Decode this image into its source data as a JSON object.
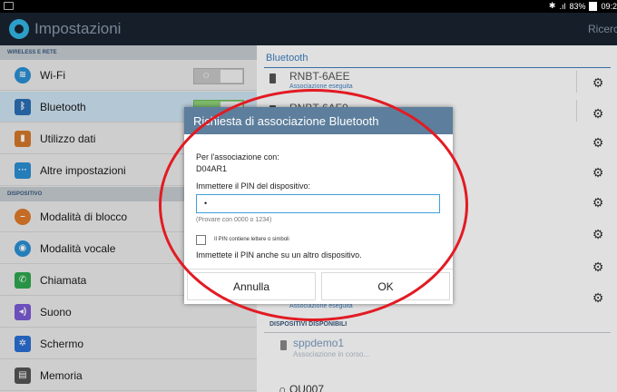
{
  "status_bar": {
    "battery": "83%",
    "time": "09:2"
  },
  "action_bar": {
    "title": "Impostazioni",
    "search": "Ricerc"
  },
  "left": {
    "section_wireless": "WIRELESS E RETE",
    "section_device": "DISPOSITIVO",
    "items": [
      {
        "label": "Wi-Fi",
        "icon": "wifi-icon",
        "color": "#2b8fd4"
      },
      {
        "label": "Bluetooth",
        "icon": "bluetooth-icon",
        "color": "#2b8fd4"
      },
      {
        "label": "Utilizzo dati",
        "icon": "data-usage-icon",
        "color": "#d4782b"
      },
      {
        "label": "Altre impostazioni",
        "icon": "more-icon",
        "color": "#2b8fd4"
      },
      {
        "label": "Modalità di blocco",
        "icon": "block-icon",
        "color": "#e07a2b"
      },
      {
        "label": "Modalità vocale",
        "icon": "voice-icon",
        "color": "#2b8fd4"
      },
      {
        "label": "Chiamata",
        "icon": "phone-icon",
        "color": "#2fa84f"
      },
      {
        "label": "Suono",
        "icon": "sound-icon",
        "color": "#7a5bd4"
      },
      {
        "label": "Schermo",
        "icon": "screen-icon",
        "color": "#2b6fd4"
      },
      {
        "label": "Memoria",
        "icon": "memory-icon",
        "color": "#555555"
      }
    ],
    "wifi_toggle": "O"
  },
  "right": {
    "header": "Bluetooth",
    "devices": [
      {
        "name": "RNBT-6AEE",
        "status": "Associazione eseguita"
      },
      {
        "name": "RNBT-6AF0",
        "status": ""
      }
    ],
    "partial_status": "Associazione eseguita",
    "section_available": "DISPOSITIVI DISPONIBILI",
    "available": [
      {
        "name": "sppdemo1",
        "status": "Associazione in corso..."
      }
    ],
    "headphones": "QU007"
  },
  "dialog": {
    "title": "Richiesta di associazione Bluetooth",
    "pairing_label": "Per l'associazione con:",
    "device": "D04AR1",
    "pin_label": "Immettere il PIN del dispositivo:",
    "pin_value": "•",
    "hint": "(Provare con 0000 o 1234)",
    "checkbox_label": "Il PIN contiene lettere o simboli",
    "other_device": "Immettete il PIN anche su un altro dispositivo.",
    "cancel": "Annulla",
    "ok": "OK"
  },
  "colors": {
    "accent": "#3f7fbf",
    "annotation": "#e21b23",
    "dialog_title": "#5d7e9c"
  }
}
